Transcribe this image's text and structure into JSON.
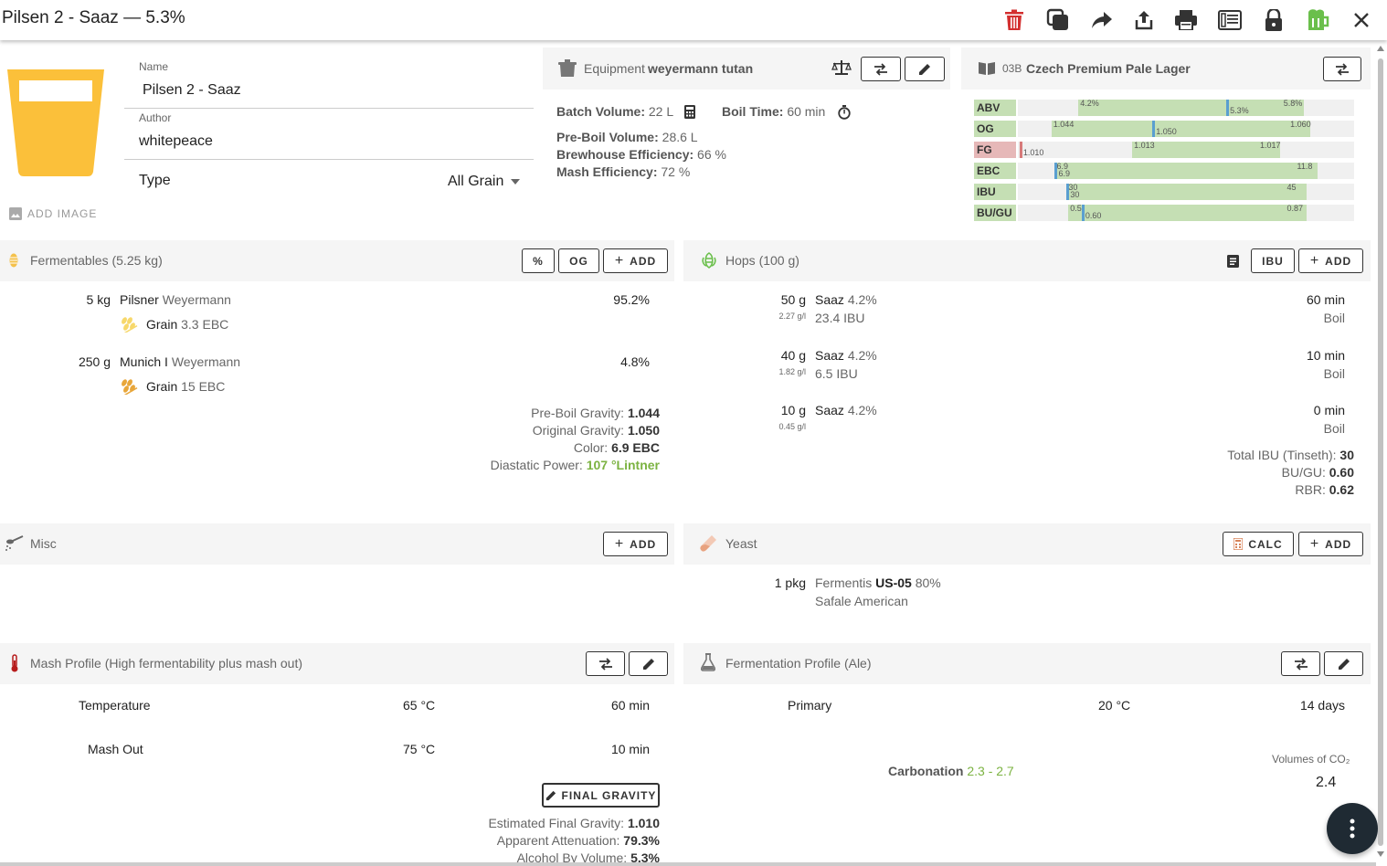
{
  "title": "Pilsen 2 - Saaz — 5.3%",
  "toolbar": {
    "icons": [
      "trash-icon",
      "copy-icon",
      "share-arrow-icon",
      "upload-icon",
      "print-icon",
      "newspaper-icon",
      "lock-icon",
      "beer-mug-icon",
      "close-icon"
    ],
    "colors": {
      "trash": "#d32f2f",
      "beer": "#6abf4b"
    }
  },
  "recipe": {
    "name_label": "Name",
    "name": "Pilsen 2 - Saaz",
    "author_label": "Author",
    "author": "whitepeace",
    "type_label": "Type",
    "type": "All Grain",
    "add_image": "ADD IMAGE",
    "beer_color": "#fbc03a"
  },
  "equipment": {
    "label": "Equipment",
    "name": "weyermann tutan",
    "batch_label": "Batch Volume:",
    "batch": "22 L",
    "boil_label": "Boil Time:",
    "boil": "60 min",
    "preboil_label": "Pre-Boil Volume:",
    "preboil": "28.6 L",
    "bh_eff_label": "Brewhouse Efficiency:",
    "bh_eff": "66 %",
    "mash_eff_label": "Mash Efficiency:",
    "mash_eff": "72 %"
  },
  "style": {
    "code": "03B",
    "name": "Czech Premium Pale Lager",
    "rows": [
      {
        "name": "ABV",
        "min_label": "4.2%",
        "max_label": "5.8%",
        "value_label": "5.3%",
        "min": 0.18,
        "max": 0.85,
        "value": 0.62,
        "warn": false
      },
      {
        "name": "OG",
        "min_label": "1.044",
        "max_label": "1.060",
        "value_label": "1.050",
        "min": 0.1,
        "max": 0.87,
        "value": 0.4,
        "warn": false
      },
      {
        "name": "FG",
        "min_label": "1.013",
        "max_label": "1.017",
        "value_label": "1.010",
        "min": 0.34,
        "max": 0.78,
        "value": 0.005,
        "warn": true
      },
      {
        "name": "EBC",
        "min_label": "6.9",
        "max_label": "11.8",
        "value_label": "6.9",
        "min": 0.11,
        "max": 0.89,
        "value": 0.11,
        "warn": false
      },
      {
        "name": "IBU",
        "min_label": "30",
        "max_label": "45",
        "value_label": "30",
        "min": 0.145,
        "max": 0.86,
        "value": 0.145,
        "warn": false
      },
      {
        "name": "BU/GU",
        "min_label": "0.5",
        "max_label": "0.87",
        "value_label": "0.60",
        "min": 0.15,
        "max": 0.86,
        "value": 0.19,
        "warn": false
      }
    ]
  },
  "fermentables": {
    "title": "Fermentables (5.25 kg)",
    "btn_pct": "%",
    "btn_og": "OG",
    "btn_add": "ADD",
    "items": [
      {
        "amount": "5 kg",
        "name": "Pilsner",
        "brand": "Weyermann",
        "kind": "Grain",
        "color": "3.3 EBC",
        "pct": "95.2%"
      },
      {
        "amount": "250 g",
        "name": "Munich I",
        "brand": "Weyermann",
        "kind": "Grain",
        "color": "15 EBC",
        "pct": "4.8%"
      }
    ],
    "preboil_label": "Pre-Boil Gravity:",
    "preboil": "1.044",
    "og_label": "Original Gravity:",
    "og": "1.050",
    "color_label": "Color:",
    "color": "6.9 EBC",
    "dp_label": "Diastatic Power:",
    "dp": "107 °Lintner"
  },
  "hops": {
    "title": "Hops (100 g)",
    "btn_ibu": "IBU",
    "btn_add": "ADD",
    "items": [
      {
        "amount": "50 g",
        "rate": "2.27 g/l",
        "name": "Saaz",
        "alpha": "4.2%",
        "ibu": "23.4 IBU",
        "time": "60 min",
        "use": "Boil"
      },
      {
        "amount": "40 g",
        "rate": "1.82 g/l",
        "name": "Saaz",
        "alpha": "4.2%",
        "ibu": "6.5 IBU",
        "time": "10 min",
        "use": "Boil"
      },
      {
        "amount": "10 g",
        "rate": "0.45 g/l",
        "name": "Saaz",
        "alpha": "4.2%",
        "ibu": "",
        "time": "0 min",
        "use": "Boil"
      }
    ],
    "total_label": "Total IBU (Tinseth):",
    "total": "30",
    "bugu_label": "BU/GU:",
    "bugu": "0.60",
    "rbr_label": "RBR:",
    "rbr": "0.62"
  },
  "misc": {
    "title": "Misc",
    "btn_add": "ADD"
  },
  "yeast": {
    "title": "Yeast",
    "btn_calc": "CALC",
    "btn_add": "ADD",
    "amount": "1 pkg",
    "lab": "Fermentis",
    "code": "US-05",
    "atten": "80%",
    "name": "Safale American"
  },
  "mash": {
    "title": "Mash Profile (High fermentability plus mash out)",
    "steps": [
      {
        "name": "Temperature",
        "temp": "65 °C",
        "time": "60 min"
      },
      {
        "name": "Mash Out",
        "temp": "75 °C",
        "time": "10 min"
      }
    ],
    "fg_btn": "FINAL GRAVITY",
    "efg_label": "Estimated Final Gravity:",
    "efg": "1.010",
    "aa_label": "Apparent Attenuation:",
    "aa": "79.3%",
    "abv_label": "Alcohol By Volume:",
    "abv": "5.3%"
  },
  "fermentation": {
    "title": "Fermentation Profile (Ale)",
    "steps": [
      {
        "name": "Primary",
        "temp": "20 °C",
        "time": "14 days"
      }
    ],
    "carb_label": "Carbonation",
    "carb_range": "2.3 - 2.7",
    "co2_label": "Volumes of CO₂",
    "co2": "2.4",
    "accent": "#7cb342"
  }
}
